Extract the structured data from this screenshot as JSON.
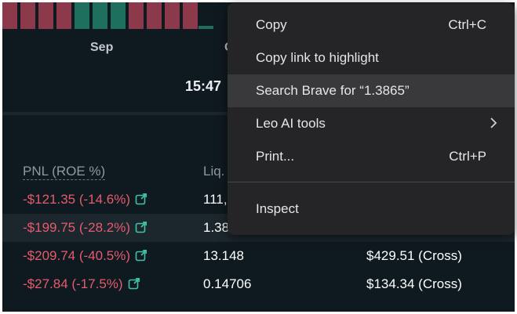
{
  "chart": {
    "x_labels": [
      "Sep",
      "O"
    ],
    "time": "15:47"
  },
  "table": {
    "headers": {
      "pnl": "PNL (ROE %)",
      "liq": "Liq."
    },
    "rows": [
      {
        "pnl": "-$121.35 (-14.6%)",
        "liq": "111,",
        "margin": ""
      },
      {
        "pnl": "-$199.75 (-28.2%)",
        "liq": "1.38",
        "margin": ""
      },
      {
        "pnl": "-$209.74 (-40.5%)",
        "liq": "13.148",
        "margin": "$429.51 (Cross)"
      },
      {
        "pnl": "-$27.84 (-17.5%)",
        "liq": "0.14706",
        "margin": "$134.34 (Cross)"
      }
    ],
    "colors": {
      "negative": "#e65a6e",
      "link_icon": "#3fc3a8"
    }
  },
  "context_menu": {
    "items": [
      {
        "label": "Copy",
        "shortcut": "Ctrl+C"
      },
      {
        "label": "Copy link to highlight",
        "shortcut": ""
      },
      {
        "label": "Search Brave for “1.3865”",
        "shortcut": ""
      },
      {
        "label": "Leo AI tools",
        "shortcut": "",
        "icon": "chevron-right-icon"
      },
      {
        "label": "Print...",
        "shortcut": "Ctrl+P"
      },
      {
        "label": "Inspect",
        "shortcut": ""
      }
    ]
  }
}
